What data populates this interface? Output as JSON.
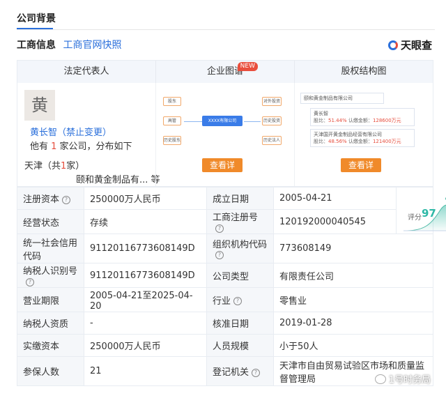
{
  "section": {
    "title": "公司背景"
  },
  "info_bar": {
    "label": "工商信息",
    "link": "工商官网快照"
  },
  "brand": {
    "name": "天眼查",
    "icon": "tianyancha-logo"
  },
  "panel": {
    "tabs": [
      "法定代表人",
      "企业图谱",
      "股权结构图"
    ],
    "new_badge": "NEW",
    "rep": {
      "avatar_char": "黄",
      "name": "黄长智（禁止变更）",
      "line2_pre": "他有 ",
      "line2_count": "1",
      "line2_post": " 家公司，分布如下",
      "region_pre": "天津（共",
      "region_count": "1",
      "region_post": "家）",
      "company": "颐和黄金制品有...  等"
    },
    "graph": {
      "left_nodes": [
        "股东",
        "高管",
        "历史股东"
      ],
      "center": "XXXX有限公司",
      "right_nodes": [
        "对外投资",
        "历史投资",
        "历史法人"
      ],
      "button": "查看详"
    },
    "equity": {
      "company": "颐和黄金制品有限公司",
      "holder1": "黄长智",
      "holder1_ratio_label": "股比：",
      "holder1_ratio": "51.44%",
      "holder1_amount_label": "认缴金额：",
      "holder1_amount": "128600万元",
      "holder2": "天津国开黄金制品经营有限公司",
      "holder2_ratio_label": "股比：",
      "holder2_ratio": "48.56%",
      "holder2_amount_label": "认缴金额：",
      "holder2_amount": "121400万元",
      "button": "查看详"
    }
  },
  "table": {
    "rows": [
      {
        "k1": "注册资本",
        "k1_help": true,
        "v1": "250000万人民币",
        "k2": "成立日期",
        "k2_help": false,
        "v2": "2005-04-21"
      },
      {
        "k1": "经营状态",
        "k1_help": false,
        "v1": "存续",
        "k2": "工商注册号",
        "k2_help": true,
        "v2": "120192000040545"
      },
      {
        "k1": "统一社会信用代码",
        "k1_help": false,
        "v1": "91120116773608149D",
        "k2": "组织机构代码",
        "k2_help": true,
        "v2": "773608149"
      },
      {
        "k1": "纳税人识别号",
        "k1_help": true,
        "v1": "91120116773608149D",
        "k2": "公司类型",
        "k2_help": false,
        "v2": "有限责任公司"
      },
      {
        "k1": "营业期限",
        "k1_help": false,
        "v1": "2005-04-21至2025-04-20",
        "k2": "行业",
        "k2_help": true,
        "v2": "零售业"
      },
      {
        "k1": "纳税人资质",
        "k1_help": false,
        "v1": "-",
        "k2": "核准日期",
        "k2_help": false,
        "v2": "2019-01-28"
      },
      {
        "k1": "实缴资本",
        "k1_help": false,
        "v1": "250000万人民币",
        "k2": "人员规模",
        "k2_help": false,
        "v2": "小于50人"
      },
      {
        "k1": "参保人数",
        "k1_help": false,
        "v1": "21",
        "k2": "登记机关",
        "k2_help": true,
        "v2": "天津市自由贸易试验区市场和质量监督管理局"
      }
    ],
    "score_label": "评分",
    "score_value": "97"
  },
  "watermark": {
    "text": "1号时务局"
  }
}
